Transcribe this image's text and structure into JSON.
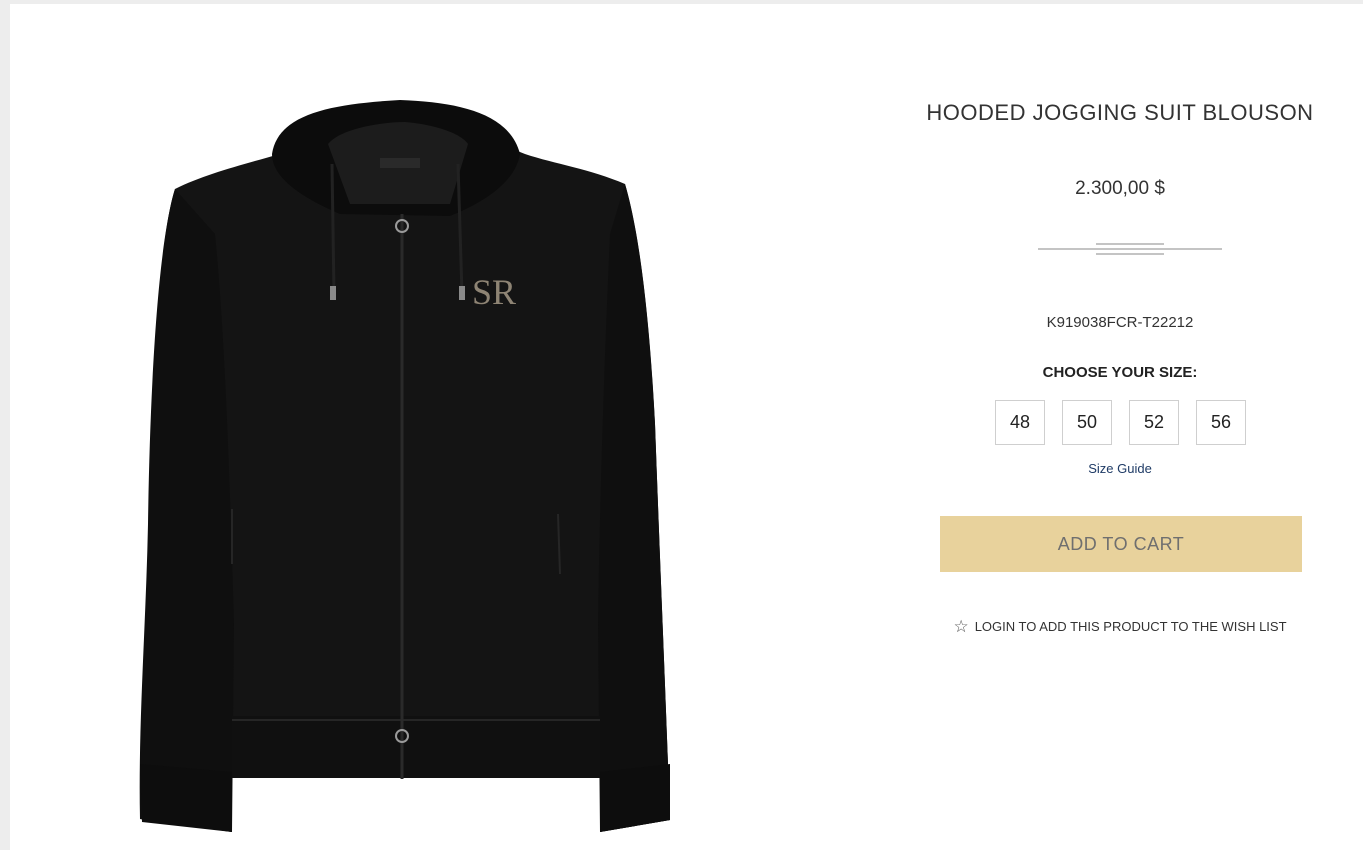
{
  "product": {
    "title": "HOODED JOGGING SUIT BLOUSON",
    "price": "2.300,00 $",
    "sku": "K919038FCR-T22212",
    "image_logo": "SR"
  },
  "size_selector": {
    "heading": "CHOOSE YOUR SIZE:",
    "sizes": [
      "48",
      "50",
      "52",
      "56"
    ],
    "guide_label": "Size Guide"
  },
  "actions": {
    "add_to_cart_label": "ADD TO CART",
    "wishlist_label": "LOGIN TO ADD THIS PRODUCT TO THE WISH LIST",
    "wishlist_icon": "star-outline-icon"
  },
  "colors": {
    "add_to_cart_bg": "#e8d29c",
    "size_guide_link": "#1f3b66",
    "garment": "#141414"
  }
}
